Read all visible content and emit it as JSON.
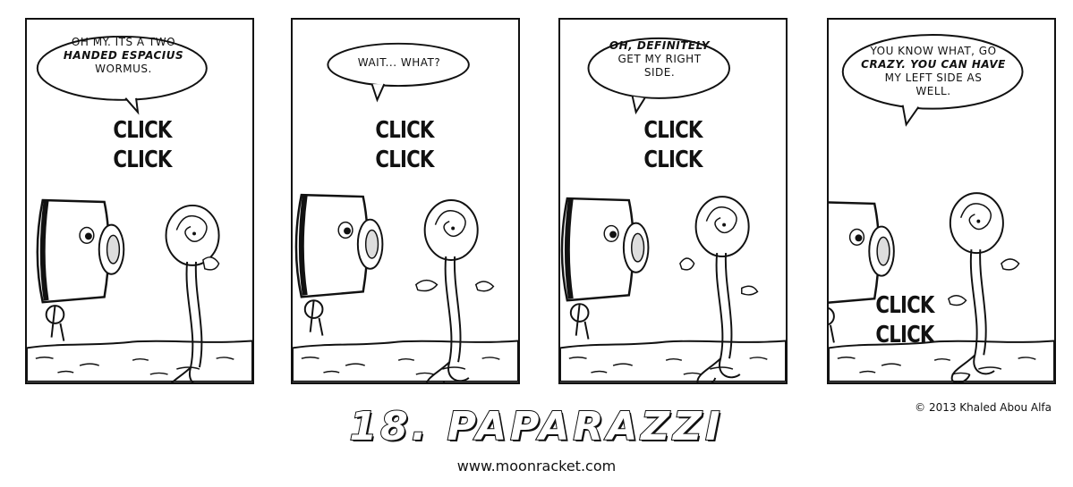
{
  "panels": [
    {
      "speech_lines": [
        "OH MY. ITS A TWO",
        "HANDED ESPACIUS",
        "WORMUS."
      ],
      "sfx": [
        "CLICK",
        "CLICK"
      ]
    },
    {
      "speech_lines": [
        "WAIT... WHAT?"
      ],
      "sfx": [
        "CLICK",
        "CLICK"
      ]
    },
    {
      "speech_lines": [
        "OH, DEFINITELY",
        "GET MY RIGHT",
        "SIDE."
      ],
      "sfx": [
        "CLICK",
        "CLICK"
      ]
    },
    {
      "speech_lines": [
        "YOU KNOW WHAT, GO",
        "CRAZY. YOU CAN HAVE",
        "MY LEFT SIDE AS",
        "WELL."
      ],
      "sfx": [
        "CLICK",
        "CLICK"
      ]
    }
  ],
  "credit": "© 2013 Khaled Abou Alfa",
  "title": "18. PAPARAZZI",
  "url": "www.moonracket.com"
}
